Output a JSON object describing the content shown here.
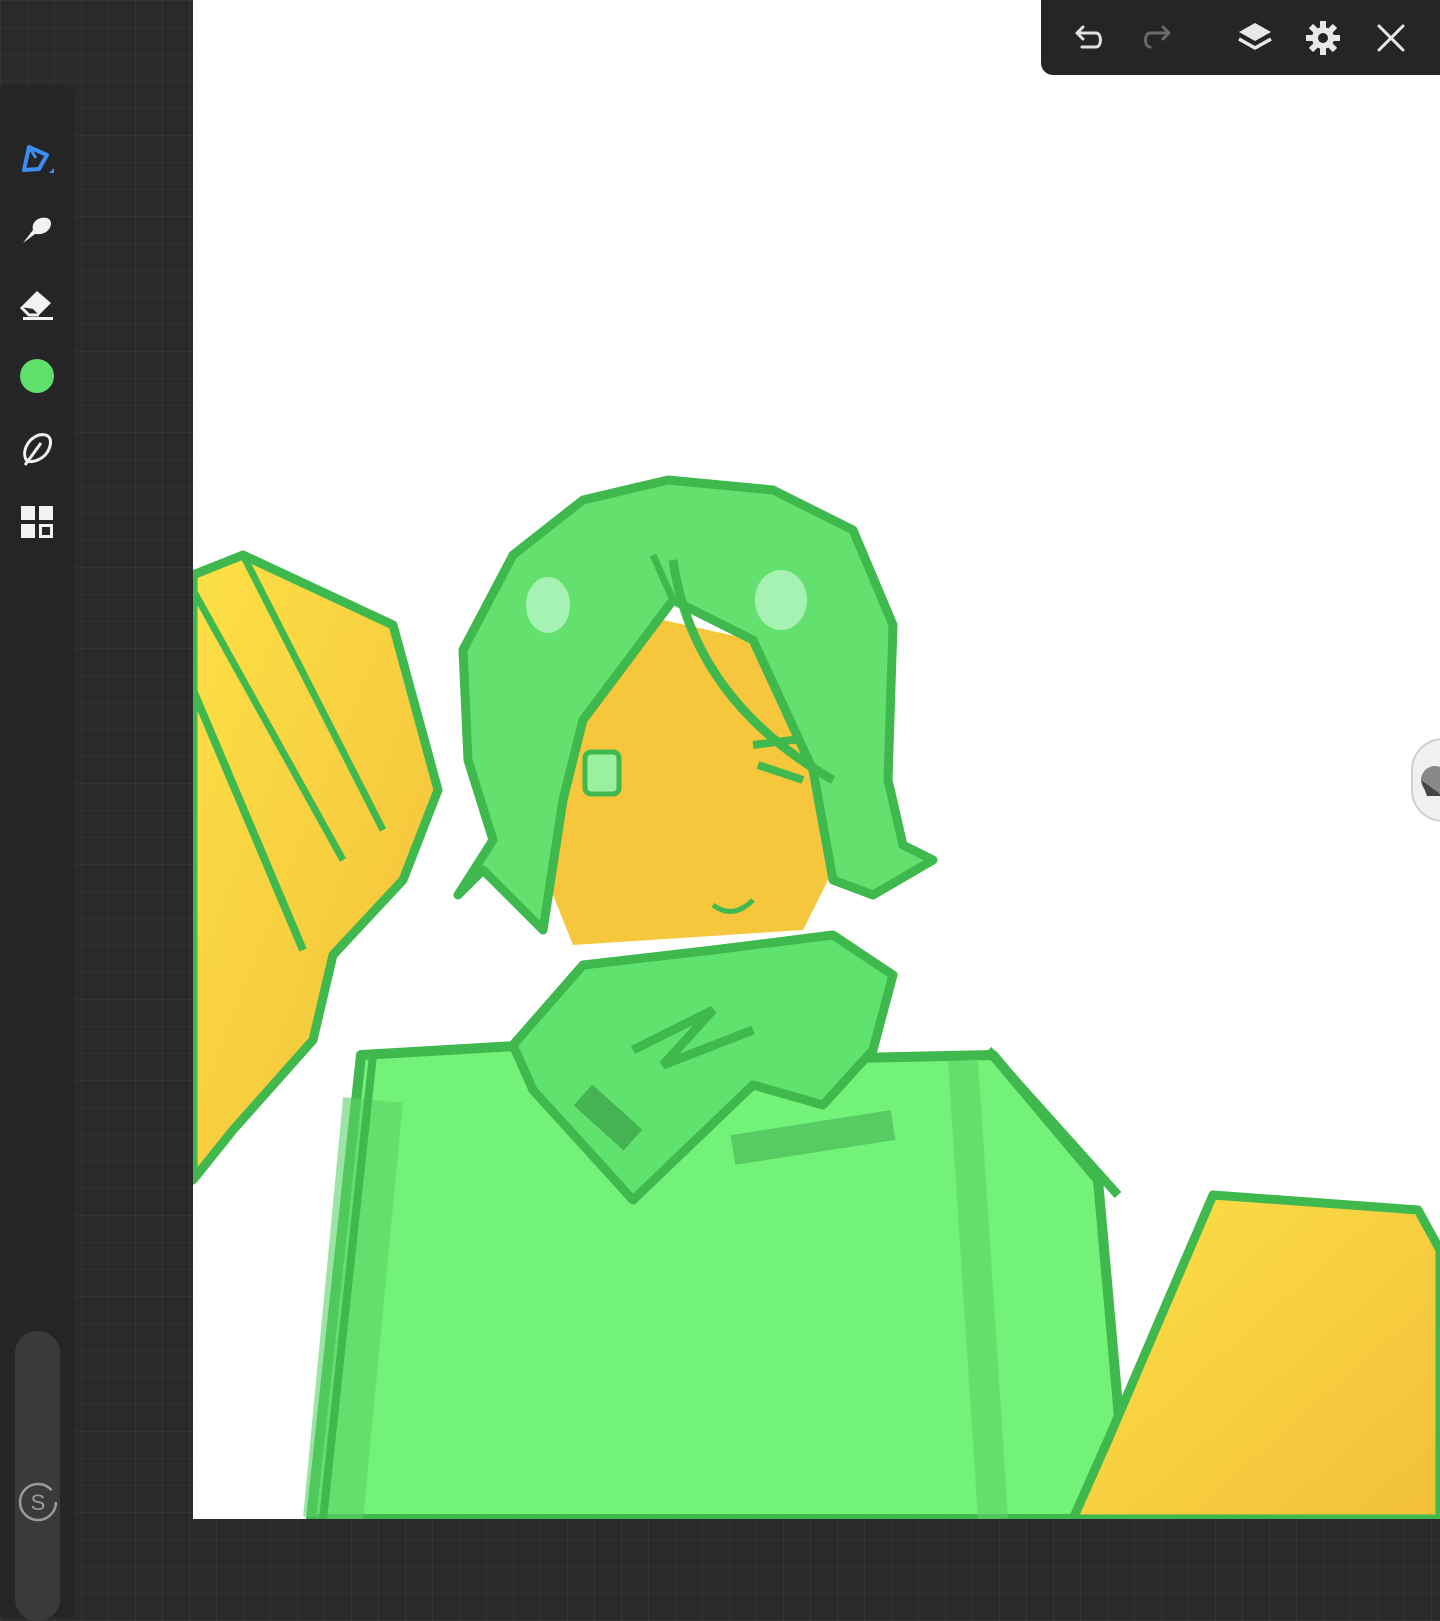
{
  "app": {
    "name": "drawing-app"
  },
  "colors": {
    "active_tool": "#3b8ff0",
    "current_color": "#5fe06a",
    "ui_panel": "#252527",
    "workspace": "#2a2a2d"
  },
  "toolbar": {
    "tools": [
      {
        "name": "pen-tool",
        "icon": "pen-icon",
        "active": true
      },
      {
        "name": "smudge-tool",
        "icon": "smudge-icon",
        "active": false
      },
      {
        "name": "eraser-tool",
        "icon": "eraser-icon",
        "active": false
      },
      {
        "name": "color-picker",
        "icon": "color-swatch",
        "active": false
      },
      {
        "name": "lasso-tool",
        "icon": "lasso-icon",
        "active": false
      },
      {
        "name": "more-tools",
        "icon": "grid-icon",
        "active": false
      }
    ],
    "sync_label": "S"
  },
  "topbar": {
    "buttons": [
      "undo-icon",
      "redo-icon",
      "layers-icon",
      "settings-icon",
      "close-icon"
    ],
    "redo_enabled": false
  }
}
